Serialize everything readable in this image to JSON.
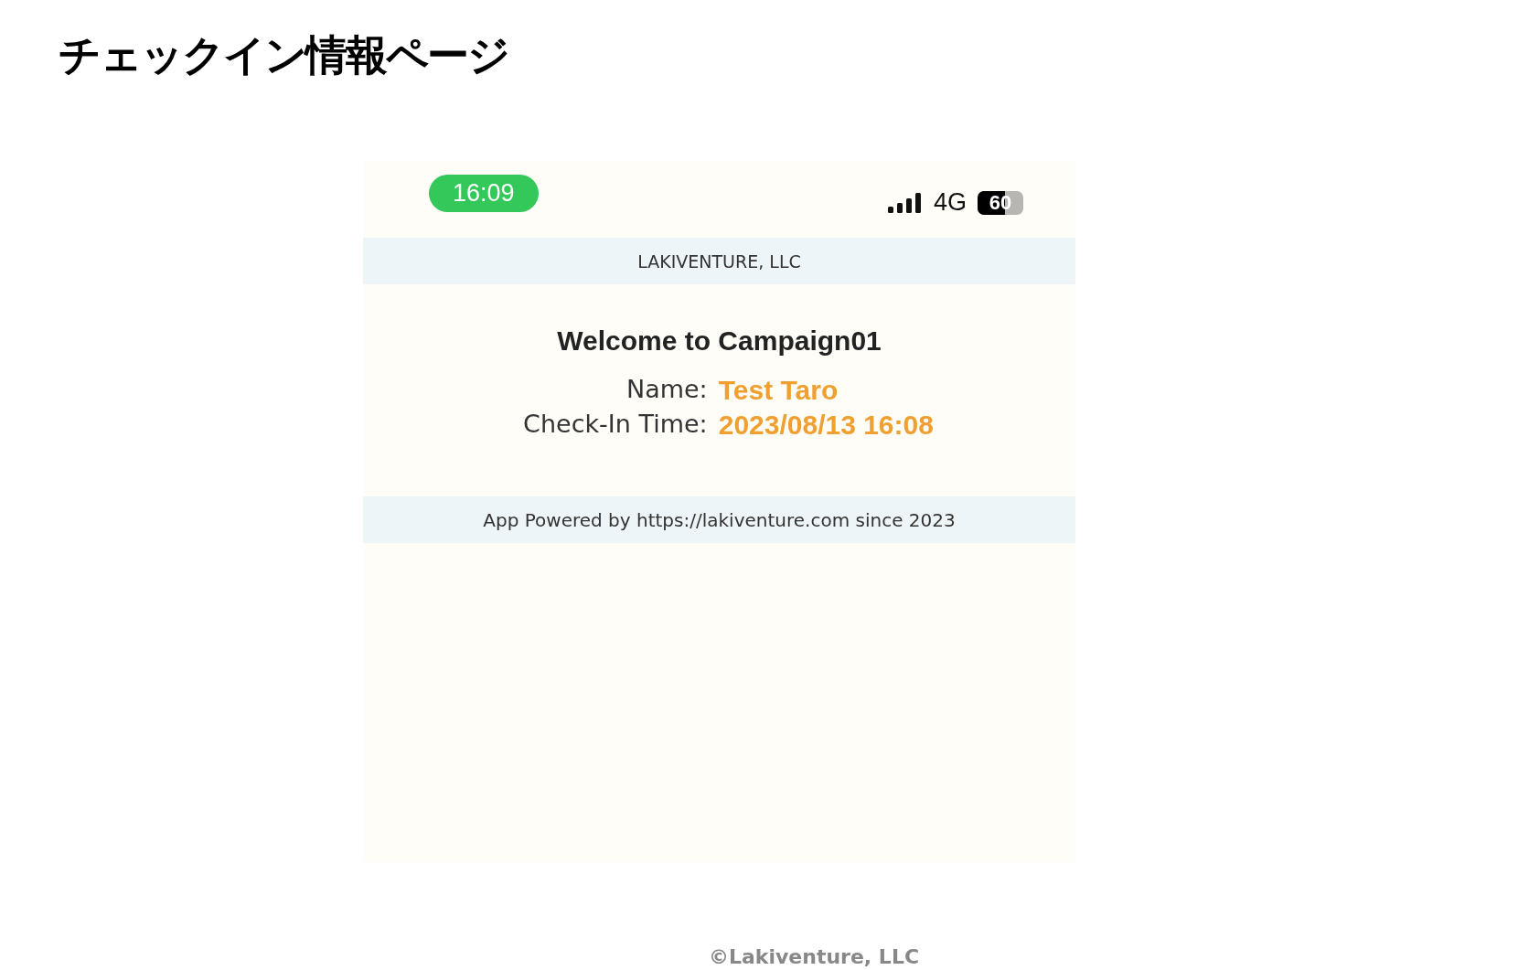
{
  "slide_title": "チェックイン情報ページ",
  "phone": {
    "status_bar": {
      "time": "16:09",
      "network": "4G",
      "battery": "60"
    },
    "header": "LAKIVENTURE, LLC",
    "welcome": "Welcome to Campaign01",
    "fields": [
      {
        "label": "Name:",
        "value": "Test Taro"
      },
      {
        "label": "Check-In Time:",
        "value": "2023/08/13 16:08"
      }
    ],
    "footer": "App Powered by https://lakiventure.com since 2023"
  },
  "copyright": "©Lakiventure, LLC"
}
